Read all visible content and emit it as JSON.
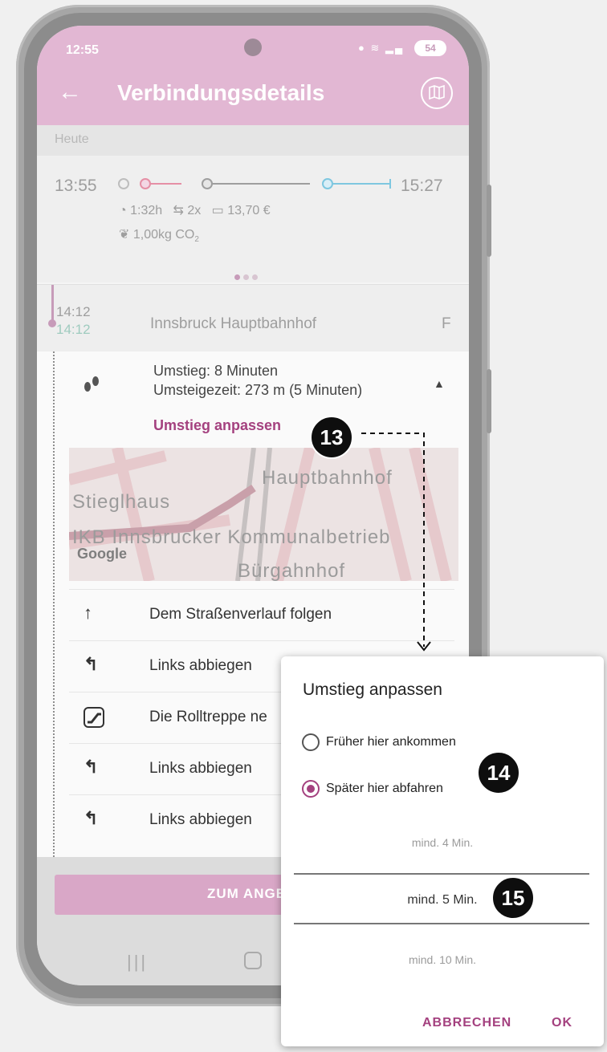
{
  "status_bar": {
    "time": "12:55",
    "battery": "54"
  },
  "header": {
    "title": "Verbindungsdetails"
  },
  "date": "Heute",
  "summary": {
    "departure": "13:55",
    "arrival": "15:27",
    "duration": "1:32h",
    "transfers": "2x",
    "price": "13,70 €",
    "co2": "1,00kg CO",
    "co2_sub": "2"
  },
  "station": {
    "time_planned": "14:12",
    "time_actual": "14:12",
    "name": "Innsbruck Hauptbahnhof",
    "platform": "F"
  },
  "transfer": {
    "line1": "Umstieg: 8 Minuten",
    "line2": "Umsteigezeit: 273 m (5 Minuten)",
    "adjust_link": "Umstieg anpassen"
  },
  "map": {
    "labels": [
      "Hauptbahnhof",
      "Stieglhaus",
      "IKB Innsbrucker Kommunalbetrieb",
      "Bürgahnhof"
    ],
    "attribution": "Google"
  },
  "steps": [
    {
      "icon": "arrow-up-icon",
      "text": "Dem Straßenverlauf folgen"
    },
    {
      "icon": "turn-left-icon",
      "text": "Links abbiegen"
    },
    {
      "icon": "escalator-icon",
      "text": "Die Rolltreppe ne"
    },
    {
      "icon": "turn-left-icon",
      "text": "Links abbiegen"
    },
    {
      "icon": "turn-left-icon",
      "text": "Links abbiegen"
    }
  ],
  "bottom_button": "ZUM ANGE",
  "callouts": [
    "13",
    "14",
    "15"
  ],
  "dialog": {
    "title": "Umstieg anpassen",
    "option_earlier": "Früher hier ankommen",
    "option_later": "Später hier abfahren",
    "picker_values": [
      "mind. 4 Min.",
      "mind. 5 Min.",
      "mind. 10 Min."
    ],
    "cancel": "ABBRECHEN",
    "ok": "OK"
  },
  "colors": {
    "accent": "#a4417f",
    "header": "#e2b7d3",
    "button": "#d9a7c7"
  }
}
